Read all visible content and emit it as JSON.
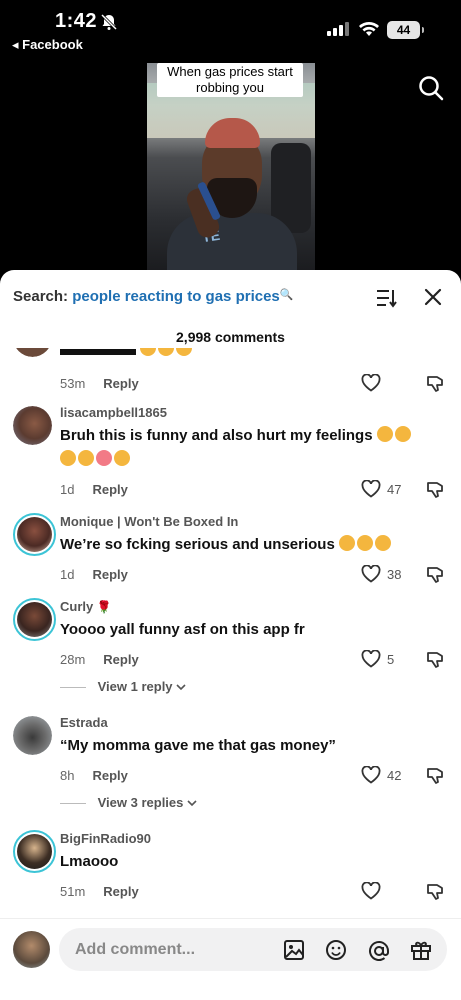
{
  "status": {
    "time": "1:42",
    "back_label": "◂ Facebook",
    "battery": "44"
  },
  "video": {
    "caption": "When gas prices start robbing you",
    "shirt_text": "TE"
  },
  "search": {
    "label": "Search:",
    "query": "people reacting to gas prices",
    "query_icon": "🔍"
  },
  "comments_count": "2,998 comments",
  "comments": [
    {
      "username": "",
      "text": "",
      "time": "53m",
      "reply": "Reply",
      "likes": ""
    },
    {
      "username": "lisacampbell1865",
      "text": "Bruh this is funny and also hurt my feelings",
      "time": "1d",
      "reply": "Reply",
      "likes": "47"
    },
    {
      "username": "Monique | Won't Be Boxed In",
      "text": "We’re so fcking serious and unserious",
      "time": "1d",
      "reply": "Reply",
      "likes": "38"
    },
    {
      "username": "Curly",
      "username_icon": "🌹",
      "text": "Yoooo yall funny asf on this app fr",
      "time": "28m",
      "reply": "Reply",
      "likes": "5",
      "view_replies": "View 1 reply"
    },
    {
      "username": "Estrada",
      "text": "“My momma gave me that gas money”",
      "time": "8h",
      "reply": "Reply",
      "likes": "42",
      "view_replies": "View 3 replies"
    },
    {
      "username": "BigFinRadio90",
      "text": "Lmaooo",
      "time": "51m",
      "reply": "Reply",
      "likes": ""
    }
  ],
  "input": {
    "placeholder": "Add comment..."
  },
  "colors": {
    "accent": "#1f6fb2",
    "ring": "#3cc4d6",
    "background": "#ffffff"
  },
  "icons": [
    "bell-off-icon",
    "signal-icon",
    "wifi-icon",
    "search-icon",
    "sort-icon",
    "close-icon",
    "heart-icon",
    "dislike-icon",
    "image-icon",
    "emoji-icon",
    "mention-icon",
    "gift-icon",
    "chevron-down-icon"
  ]
}
